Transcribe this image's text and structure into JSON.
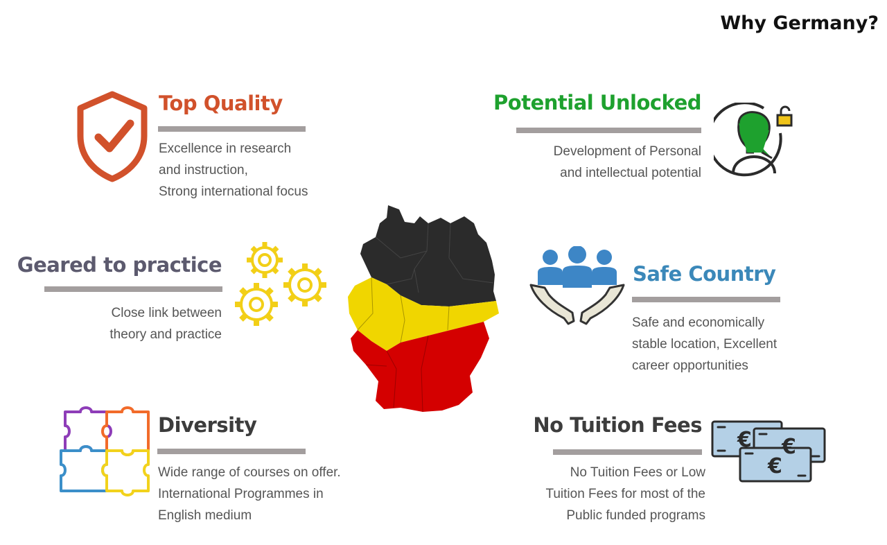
{
  "title": "Why Germany?",
  "colors": {
    "top_quality": "#d1512b",
    "potential": "#1ea12e",
    "geared": "#5c5a6e",
    "safe": "#3b88b9",
    "diversity": "#3c3c3c",
    "fees": "#3c3c3c",
    "bar": "#a39e9e",
    "text": "#555555",
    "map_black": "#2b2b2b",
    "map_yellow": "#f0d600",
    "map_red": "#d40000"
  },
  "items": {
    "top_quality": {
      "icon": "shield-check-icon",
      "heading": "Top Quality",
      "lines": [
        "Excellence in research",
        "and instruction,",
        "Strong international focus"
      ]
    },
    "potential": {
      "icon": "person-unlock-icon",
      "heading": "Potential Unlocked",
      "lines": [
        "Development of Personal",
        "and intellectual potential"
      ]
    },
    "geared": {
      "icon": "gears-icon",
      "heading": "Geared to practice",
      "lines": [
        "Close link between",
        "theory and practice"
      ]
    },
    "safe": {
      "icon": "people-hands-icon",
      "heading": "Safe Country",
      "lines": [
        "Safe and economically",
        "stable location, Excellent",
        "career opportunities"
      ]
    },
    "diversity": {
      "icon": "puzzle-icon",
      "heading": "Diversity",
      "lines": [
        "Wide range of courses on offer.",
        "International Programmes in",
        "English medium"
      ]
    },
    "fees": {
      "icon": "euro-banknotes-icon",
      "heading": "No Tuition Fees",
      "lines": [
        "No Tuition Fees or Low",
        "Tuition Fees for most of the",
        "Public funded programs"
      ]
    }
  },
  "map": {
    "icon": "germany-map-icon"
  }
}
